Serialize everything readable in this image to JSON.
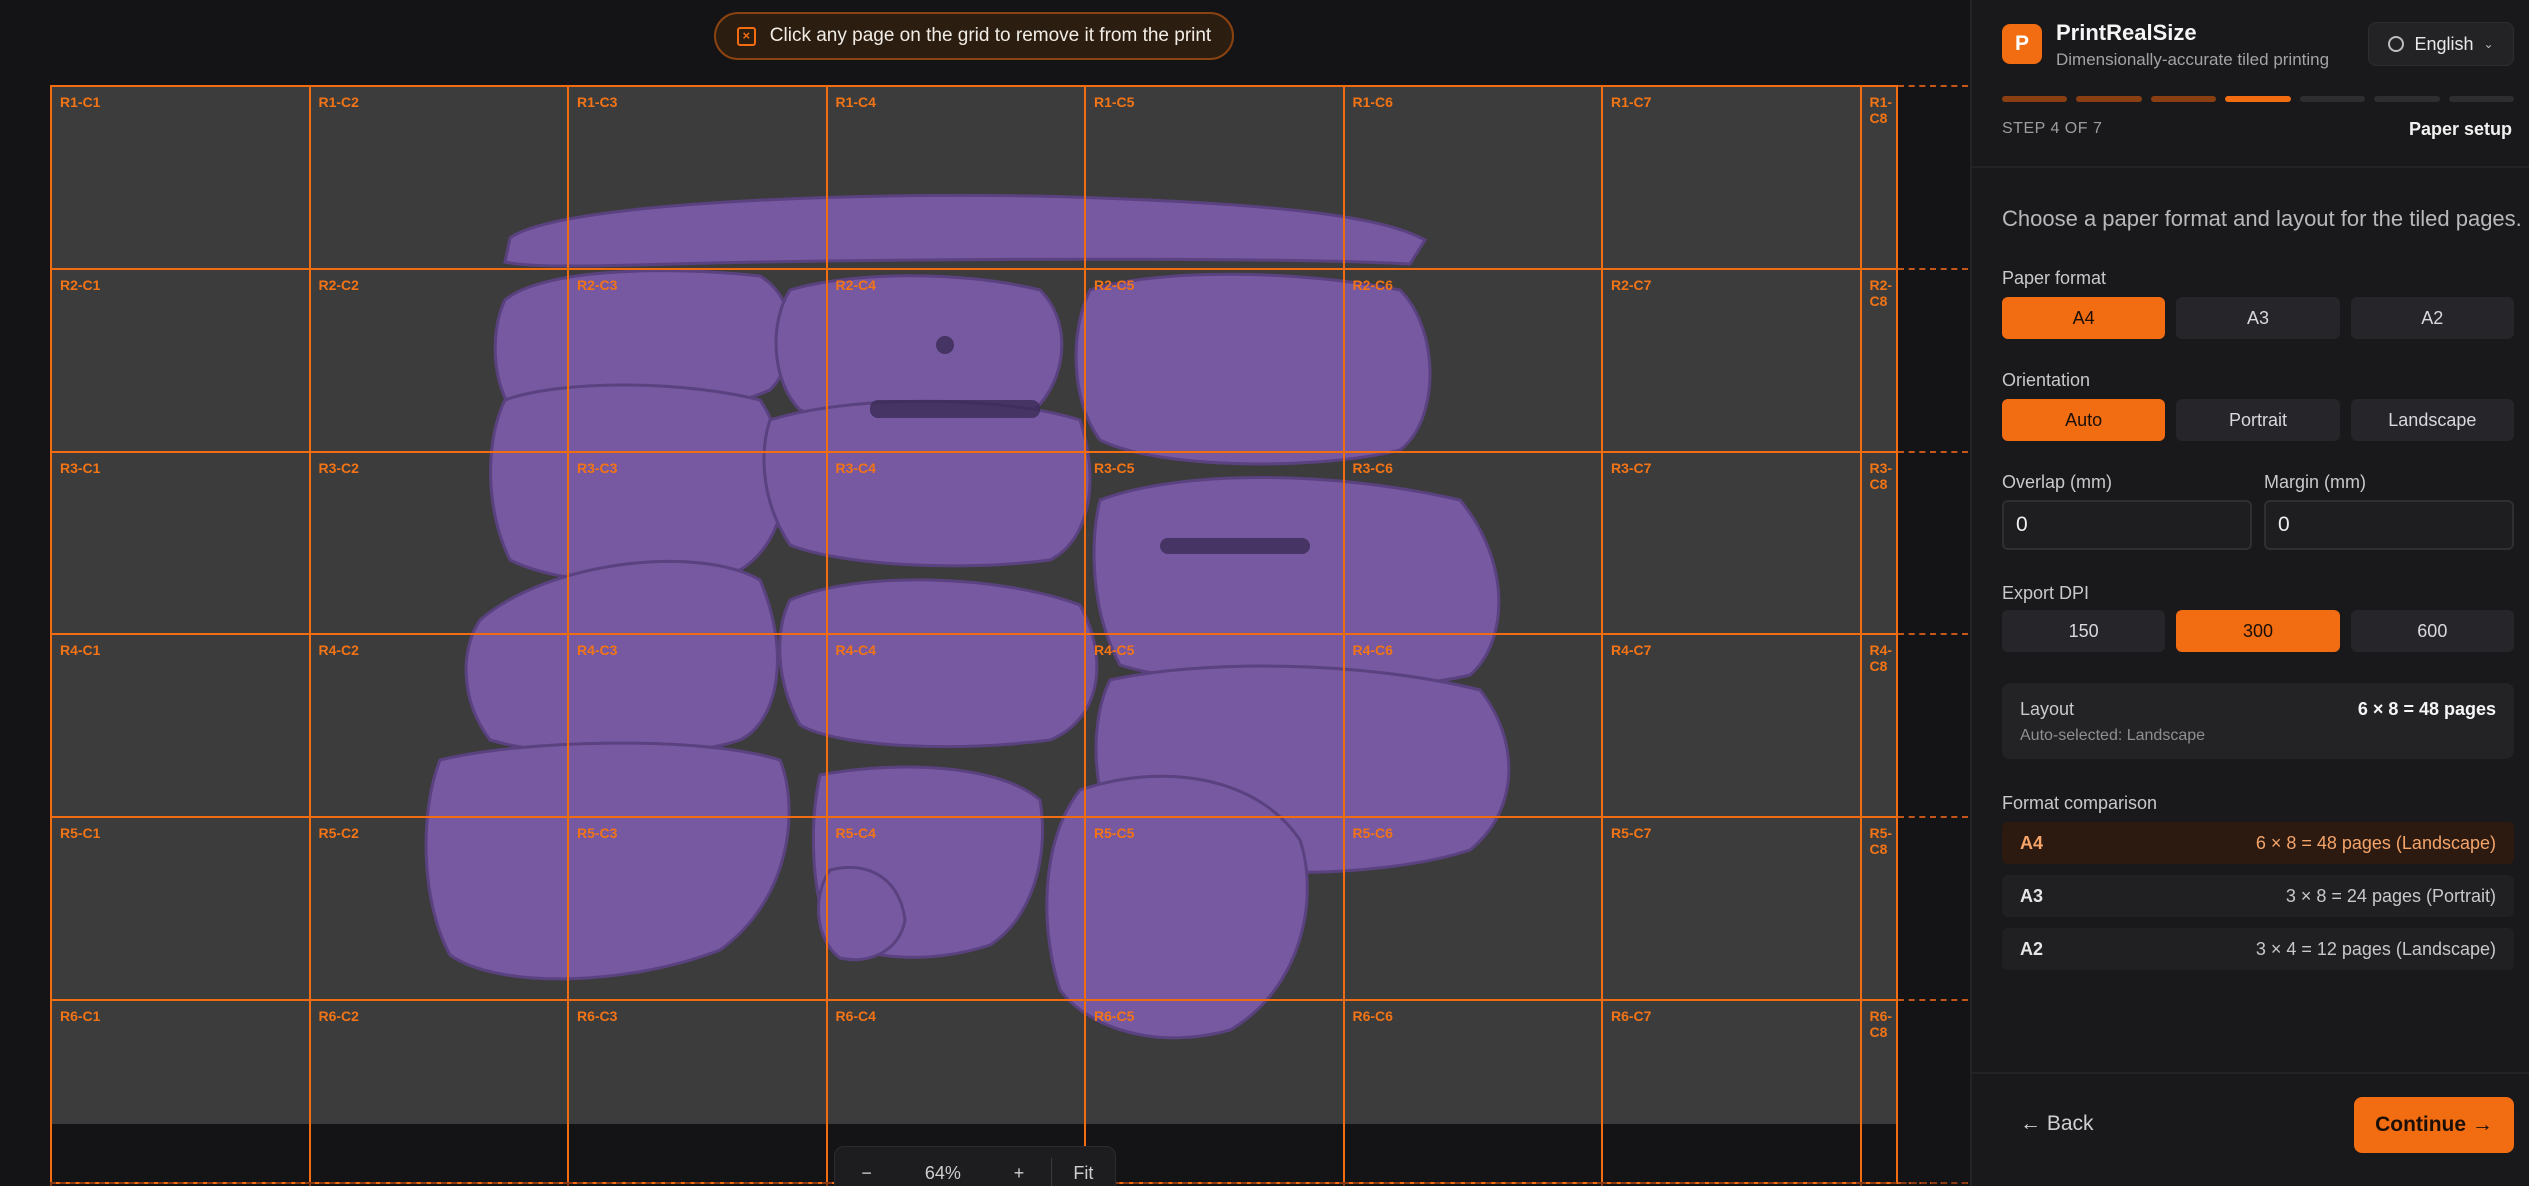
{
  "hint": {
    "text": "Click any page on the grid to remove it from the print",
    "icon": "remove-icon"
  },
  "grid": {
    "rows": [
      "R1",
      "R2",
      "R3",
      "R4",
      "R5",
      "R6"
    ],
    "cols": [
      "C1",
      "C2",
      "C3",
      "C4",
      "C5",
      "C6",
      "C7",
      "C8"
    ],
    "labels": [
      [
        "R1-C1",
        "R1-C2",
        "R1-C3",
        "R1-C4",
        "R1-C5",
        "R1-C6",
        "R1-C7",
        "R1-C8"
      ],
      [
        "R2-C1",
        "R2-C2",
        "R2-C3",
        "R2-C4",
        "R2-C5",
        "R2-C6",
        "R2-C7",
        "R2-C8"
      ],
      [
        "R3-C1",
        "R3-C2",
        "R3-C3",
        "R3-C4",
        "R3-C5",
        "R3-C6",
        "R3-C7",
        "R3-C8"
      ],
      [
        "R4-C1",
        "R4-C2",
        "R4-C3",
        "R4-C4",
        "R4-C5",
        "R4-C6",
        "R4-C7",
        "R4-C8"
      ],
      [
        "R5-C1",
        "R5-C2",
        "R5-C3",
        "R5-C4",
        "R5-C5",
        "R5-C6",
        "R5-C7",
        "R5-C8"
      ],
      [
        "R6-C1",
        "R6-C2",
        "R6-C3",
        "R6-C4",
        "R6-C5",
        "R6-C6",
        "R6-C7",
        "R6-C8"
      ]
    ],
    "accent": "#f26c12",
    "artwork_color": "#7b5ca8"
  },
  "zoom": {
    "minus": "−",
    "value": "64%",
    "plus": "+",
    "fit": "Fit"
  },
  "app": {
    "logo": "P",
    "title": "PrintRealSize",
    "subtitle": "Dimensionally-accurate tiled printing"
  },
  "language": {
    "value": "English",
    "icon": "globe-icon"
  },
  "progress": {
    "current": 4,
    "total": 7
  },
  "step": {
    "counter": "STEP 4 OF 7",
    "name": "Paper setup"
  },
  "intro": "Choose a paper format and layout for the tiled pages.",
  "paper_format": {
    "label": "Paper format",
    "options": [
      "A4",
      "A3",
      "A2"
    ],
    "selected": "A4"
  },
  "orientation": {
    "label": "Orientation",
    "options": [
      "Auto",
      "Portrait",
      "Landscape"
    ],
    "selected": "Auto"
  },
  "overlap": {
    "label": "Overlap (mm)",
    "value": "0"
  },
  "margin": {
    "label": "Margin (mm)",
    "value": "0"
  },
  "dpi": {
    "label": "Export DPI",
    "options": [
      "150",
      "300",
      "600"
    ],
    "selected": "300"
  },
  "layout": {
    "label": "Layout",
    "value": "6 × 8 = 48 pages",
    "sub": "Auto-selected: Landscape"
  },
  "comparison": {
    "label": "Format comparison",
    "rows": [
      {
        "format": "A4",
        "result": "6 × 8 = 48 pages (Landscape)",
        "selected": true
      },
      {
        "format": "A3",
        "result": "3 × 8 = 24 pages (Portrait)",
        "selected": false
      },
      {
        "format": "A2",
        "result": "3 × 4 = 12 pages (Landscape)",
        "selected": false
      }
    ]
  },
  "nav": {
    "back": "← Back",
    "continue": "Continue →"
  }
}
